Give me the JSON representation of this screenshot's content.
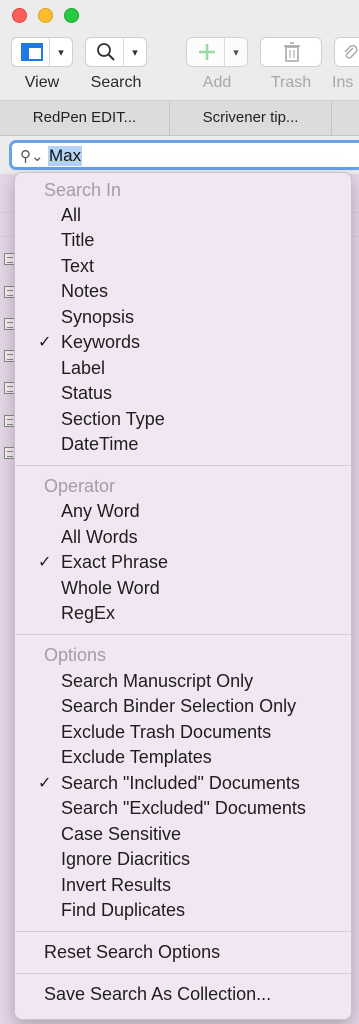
{
  "toolbar": {
    "view_label": "View",
    "search_label": "Search",
    "add_label": "Add",
    "trash_label": "Trash",
    "insert_label": "Ins"
  },
  "tabs": [
    "RedPen EDIT...",
    "Scrivener tip..."
  ],
  "search": {
    "value": "Max"
  },
  "menu": {
    "search_in": {
      "header": "Search In",
      "items": [
        {
          "label": "All",
          "checked": false
        },
        {
          "label": "Title",
          "checked": false
        },
        {
          "label": "Text",
          "checked": false
        },
        {
          "label": "Notes",
          "checked": false
        },
        {
          "label": "Synopsis",
          "checked": false
        },
        {
          "label": "Keywords",
          "checked": true
        },
        {
          "label": "Label",
          "checked": false
        },
        {
          "label": "Status",
          "checked": false
        },
        {
          "label": "Section Type",
          "checked": false
        },
        {
          "label": "DateTime",
          "checked": false
        }
      ]
    },
    "operator": {
      "header": "Operator",
      "items": [
        {
          "label": "Any Word",
          "checked": false
        },
        {
          "label": "All Words",
          "checked": false
        },
        {
          "label": "Exact Phrase",
          "checked": true
        },
        {
          "label": "Whole Word",
          "checked": false
        },
        {
          "label": "RegEx",
          "checked": false
        }
      ]
    },
    "options": {
      "header": "Options",
      "items": [
        {
          "label": "Search Manuscript Only",
          "checked": false
        },
        {
          "label": "Search Binder Selection Only",
          "checked": false
        },
        {
          "label": "Exclude Trash Documents",
          "checked": false
        },
        {
          "label": "Exclude Templates",
          "checked": false
        },
        {
          "label": "Search \"Included\" Documents",
          "checked": true
        },
        {
          "label": "Search \"Excluded\" Documents",
          "checked": false
        },
        {
          "label": "Case Sensitive",
          "checked": false
        },
        {
          "label": "Ignore Diacritics",
          "checked": false
        },
        {
          "label": "Invert Results",
          "checked": false
        },
        {
          "label": "Find Duplicates",
          "checked": false
        }
      ]
    },
    "reset_label": "Reset Search Options",
    "save_label": "Save Search As Collection...",
    "check_glyph": "✓"
  }
}
